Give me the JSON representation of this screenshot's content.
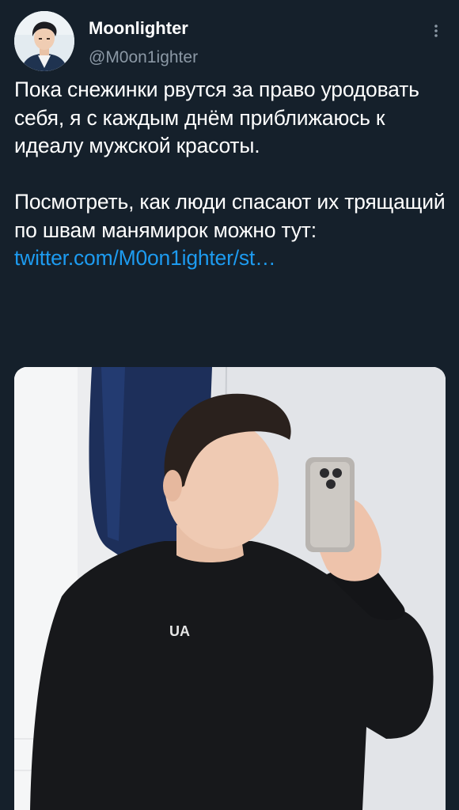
{
  "tweet": {
    "author_name": "Moonlighter",
    "author_handle": "@M0on1ighter",
    "text_paragraph_1": "Пока снежинки рвутся за право уродовать себя, я с каждым днём приближаюсь к идеалу мужской красоты.",
    "text_paragraph_2": "Посмотреть, как люди спасают их трящащий по швам манямирок можно тут:",
    "link_text": "twitter.com/M0on1ighter/st…",
    "more_icon": "vertical-ellipsis-icon",
    "avatar_icon": "profile-avatar",
    "media_icon": "selfie-photo",
    "shirt_logo_text": "UA"
  },
  "colors": {
    "background": "#15202b",
    "text": "#ffffff",
    "secondary_text": "#8b98a5",
    "link": "#1d9bf0"
  }
}
